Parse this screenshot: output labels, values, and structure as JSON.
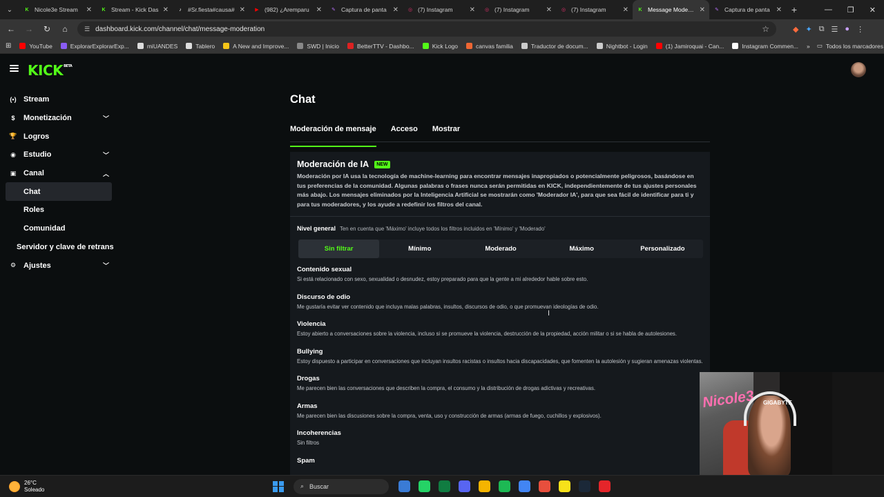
{
  "browser": {
    "tabs": [
      {
        "title": "Nicole3e Stream",
        "color": "#53fc18",
        "glyph": "K",
        "active": false
      },
      {
        "title": "Stream - Kick Das",
        "color": "#53fc18",
        "glyph": "K",
        "active": false
      },
      {
        "title": "#Sr.fiesta#causa#",
        "color": "#ffffff",
        "glyph": "♪",
        "active": false
      },
      {
        "title": "(982) ¿Aremparu",
        "color": "#ff0000",
        "glyph": "▶",
        "active": false
      },
      {
        "title": "Captura de panta",
        "color": "#b06cf0",
        "glyph": "✎",
        "active": false
      },
      {
        "title": "(7) Instagram",
        "color": "#e1306c",
        "glyph": "◎",
        "active": false
      },
      {
        "title": "(7) Instagram",
        "color": "#e1306c",
        "glyph": "◎",
        "active": false
      },
      {
        "title": "(7) Instagram",
        "color": "#e1306c",
        "glyph": "◎",
        "active": false
      },
      {
        "title": "Message Moderati",
        "color": "#53fc18",
        "glyph": "K",
        "active": true
      },
      {
        "title": "Captura de panta",
        "color": "#b06cf0",
        "glyph": "✎",
        "active": false
      }
    ],
    "url": "dashboard.kick.com/channel/chat/message-moderation",
    "bookmarks": [
      {
        "label": "YouTube",
        "color": "#ff0000"
      },
      {
        "label": "ExplorarExplorarExp...",
        "color": "#8a5cf5"
      },
      {
        "label": "miUANDES",
        "color": "#dddddd"
      },
      {
        "label": "Tablero",
        "color": "#dddddd"
      },
      {
        "label": "A New and Improve...",
        "color": "#f5c518"
      },
      {
        "label": "SWD | Inicio",
        "color": "#888888"
      },
      {
        "label": "BetterTTV - Dashbo...",
        "color": "#d22"
      },
      {
        "label": "Kick Logo",
        "color": "#53fc18"
      },
      {
        "label": "canvas familia",
        "color": "#e63"
      },
      {
        "label": "Traductor de docum...",
        "color": "#ccc"
      },
      {
        "label": "Nightbot - Login",
        "color": "#ccc"
      },
      {
        "label": "(1) Jamiroquai - Can...",
        "color": "#ff0000"
      },
      {
        "label": "Instagram Commen...",
        "color": "#fff"
      }
    ],
    "all_bookmarks": "Todos los marcadores"
  },
  "app": {
    "logo": "KICK",
    "logo_tag": "BETA",
    "accent": "#53fc18"
  },
  "sidebar": {
    "items": [
      {
        "label": "Stream",
        "icon": "(•)"
      },
      {
        "label": "Monetización",
        "icon": "$"
      },
      {
        "label": "Logros",
        "icon": "🏆"
      },
      {
        "label": "Estudio",
        "icon": "◉"
      },
      {
        "label": "Canal",
        "icon": "▣"
      }
    ],
    "sub": [
      "Chat",
      "Roles",
      "Comunidad"
    ],
    "server": "Servidor y clave de retrans",
    "settings": {
      "label": "Ajustes",
      "icon": "⚙"
    }
  },
  "main": {
    "title": "Chat",
    "tabs": [
      "Moderación de mensaje",
      "Acceso",
      "Mostrar"
    ]
  },
  "panel": {
    "title": "Moderación de IA",
    "badge": "NEW",
    "description": "Moderación por IA usa la tecnología de machine-learning para encontrar mensajes inapropiados o potencialmente peligrosos, basándose en tus preferencias de la comunidad. Algunas palabras o frases nunca serán permitidas en KICK, independientemente de tus ajustes personales más abajo. Los mensajes eliminados por la Inteligencia Artificial se mostrarán como 'Moderador IA', para que sea fácil de identificar para ti y para tus moderadores, y los ayude a redefinir los filtros del canal.",
    "level_label": "Nivel general",
    "level_note": "Ten en cuenta que 'Máximo' incluye todos los filtros incluidos en 'Mínimo' y 'Moderado'",
    "levels": [
      "Sin filtrar",
      "Mínimo",
      "Moderado",
      "Máximo",
      "Personalizado"
    ],
    "categories": [
      {
        "title": "Contenido sexual",
        "desc": "Si está relacionado con sexo, sexualidad o desnudez, estoy preparado para que la gente a mi alrededor hable sobre esto."
      },
      {
        "title": "Discurso de odio",
        "desc": "Me gustaría evitar ver contenido que incluya malas palabras, insultos, discursos de odio, o que promuevan ideologías de odio."
      },
      {
        "title": "Violencia",
        "desc": "Estoy abierto a conversaciones sobre la violencia, incluso si se promueve la violencia, destrucción de la propiedad, acción militar o si se habla de autolesiones."
      },
      {
        "title": "Bullying",
        "desc": "Estoy dispuesto a participar en conversaciones que incluyan insultos racistas o insultos hacia discapacidades, que fomenten la autolesión y sugieran amenazas violentas."
      },
      {
        "title": "Drogas",
        "desc": "Me parecen bien las conversaciones que describen la compra, el consumo y la distribución de drogas adictivas y recreativas."
      },
      {
        "title": "Armas",
        "desc": "Me parecen bien las discusiones sobre la compra, venta, uso y construcción de armas (armas de fuego, cuchillos y explosivos)."
      },
      {
        "title": "Incoherencias",
        "desc": "Sin filtros"
      },
      {
        "title": "Spam",
        "desc": ""
      }
    ]
  },
  "overlay": {
    "sign": "Nicole3",
    "brand": "GIGABYTE"
  },
  "taskbar": {
    "temp": "26°C",
    "condition": "Soleado",
    "search": "Buscar",
    "icons": [
      "#3a7bd5",
      "#25d366",
      "#107c41",
      "#5865f2",
      "#f5b400",
      "#1db954",
      "#4285f4",
      "#e84f3d",
      "#f7e11a",
      "#1b2838",
      "#e5252a"
    ]
  }
}
